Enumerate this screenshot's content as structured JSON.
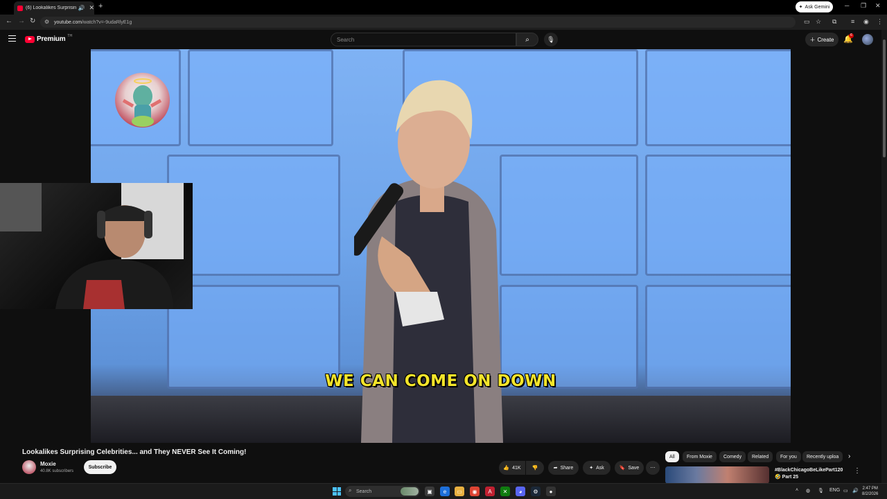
{
  "browser": {
    "tab_title": "(6) Lookalikes Surprising Ce",
    "new_tab": "+",
    "ask_gemini": "Ask Gemini",
    "url_host": "youtube.com",
    "url_path": "/watch?v=-9udaRlyE1g"
  },
  "youtube": {
    "logo_text": "Premium",
    "logo_region": "TH",
    "search_placeholder": "Search",
    "create_label": "Create",
    "notification_count": "6"
  },
  "video": {
    "caption": "WE CAN COME ON DOWN",
    "title": "Lookalikes Surprising Celebrities... and They NEVER See It Coming!"
  },
  "channel": {
    "name": "Moxie",
    "subscribers": "40.8K subscribers",
    "subscribe_label": "Subscribe"
  },
  "actions": {
    "likes": "41K",
    "share": "Share",
    "ask": "Ask",
    "save": "Save"
  },
  "chips": [
    "All",
    "From Moxie",
    "Comedy",
    "Related",
    "For you",
    "Recently uploa"
  ],
  "recommendation": {
    "title": "#BlackChicagoBeLikePart120🤣 Part 25"
  },
  "taskbar": {
    "search": "Search",
    "lang": "ENG",
    "time": "2:47 PM",
    "date": "8/2/2026"
  },
  "colors": {
    "accent": "#ff0033",
    "caption": "#f4e52a",
    "background": "#0f0f0f"
  }
}
